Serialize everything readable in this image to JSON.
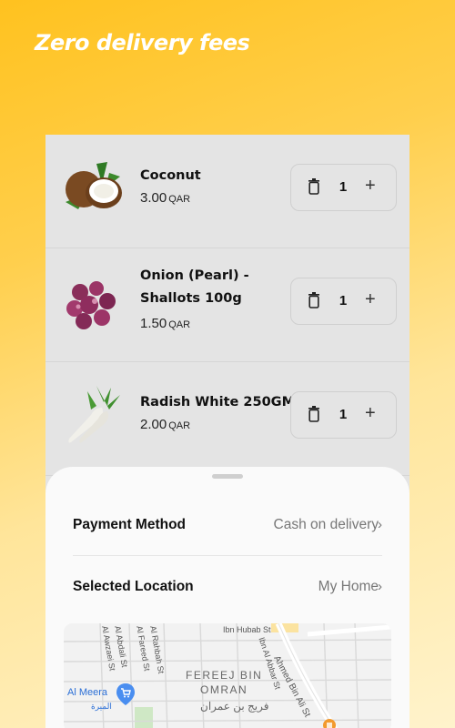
{
  "promo": {
    "title": "Zero delivery fees"
  },
  "cart": {
    "items": [
      {
        "name": "Coconut",
        "price": "3.00",
        "currency": "QAR",
        "quantity": "1"
      },
      {
        "name": "Onion (Pearl) - Shallots 100g",
        "price": "1.50",
        "currency": "QAR",
        "quantity": "1"
      },
      {
        "name": "Radish White 250GM",
        "price": "2.00",
        "currency": "QAR",
        "quantity": "1"
      }
    ]
  },
  "sheet": {
    "payment_label": "Payment Method",
    "payment_value": "Cash on delivery",
    "location_label": "Selected Location",
    "location_value": "My Home"
  },
  "map": {
    "district_line1": "FEREEJ BIN",
    "district_line2": "OMRAN",
    "district_arabic": "فريج بن عمران",
    "poi_name": "Al Meera",
    "poi_arabic": "الميرة",
    "streets": [
      "Ibn Hubab St",
      "Ahmed Bin Ali St",
      "Ibn Al Abbar St",
      "Al Rahbah St",
      "Al Fareed St",
      "Al Abdali St",
      "Al Awzaei St"
    ]
  },
  "colors": {
    "accent": "#ffc21f",
    "panel": "#fafafa"
  }
}
